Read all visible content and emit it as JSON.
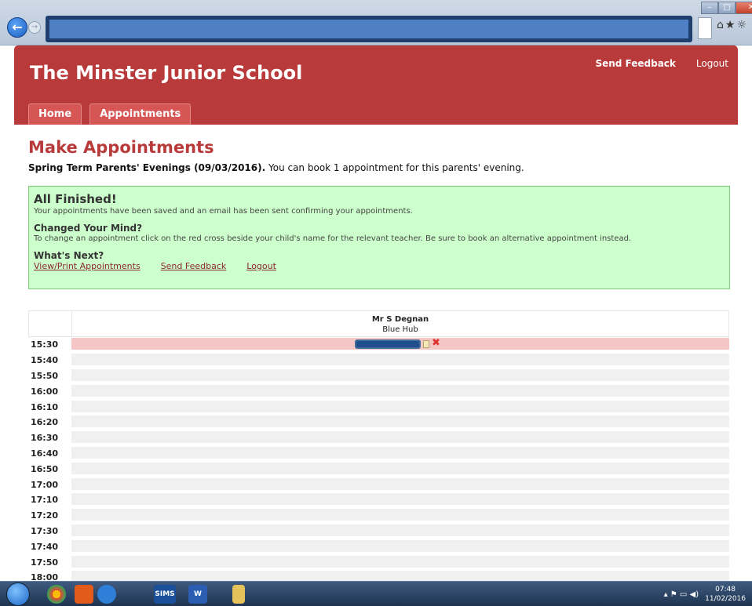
{
  "browser": {
    "back_glyph": "←",
    "forward_glyph": "→",
    "icons": "⌂★☼",
    "window_controls": [
      "–",
      "□",
      "✕"
    ]
  },
  "header": {
    "site_title": "The Minster Junior School",
    "links": {
      "send_feedback": "Send Feedback",
      "logout": "Logout"
    },
    "nav_tabs": [
      "Home",
      "Appointments"
    ]
  },
  "page": {
    "title": "Make Appointments",
    "subtitle_bold": "Spring Term Parents' Evenings (09/03/2016).",
    "subtitle_rest": " You can book 1 appointment for this parents' evening."
  },
  "notice": {
    "heading": "All Finished!",
    "saved_text": "Your appointments have been saved and an email has been sent confirming your appointments.",
    "changed_heading": "Changed Your Mind?",
    "changed_text": "To change an appointment click on the red cross beside your child's name for the relevant teacher. Be sure to book an alternative appointment instead.",
    "next_heading": "What's Next?",
    "links": [
      "View/Print Appointments",
      "Send Feedback",
      "Logout"
    ]
  },
  "schedule": {
    "teacher_name": "Mr S Degnan",
    "teacher_location": "Blue Hub",
    "booked_time": "15:30",
    "times": [
      "15:30",
      "15:40",
      "15:50",
      "16:00",
      "16:10",
      "16:20",
      "16:30",
      "16:40",
      "16:50",
      "17:00",
      "17:10",
      "17:20",
      "17:30",
      "17:40",
      "17:50",
      "18:00"
    ]
  },
  "taskbar": {
    "apps": [
      "SIMS",
      "W"
    ],
    "clock_time": "07:48",
    "clock_date": "11/02/2016"
  },
  "colors": {
    "brand": "#b93a3a",
    "success_bg": "#ccffcc",
    "booked_row": "#f4c6c6"
  }
}
